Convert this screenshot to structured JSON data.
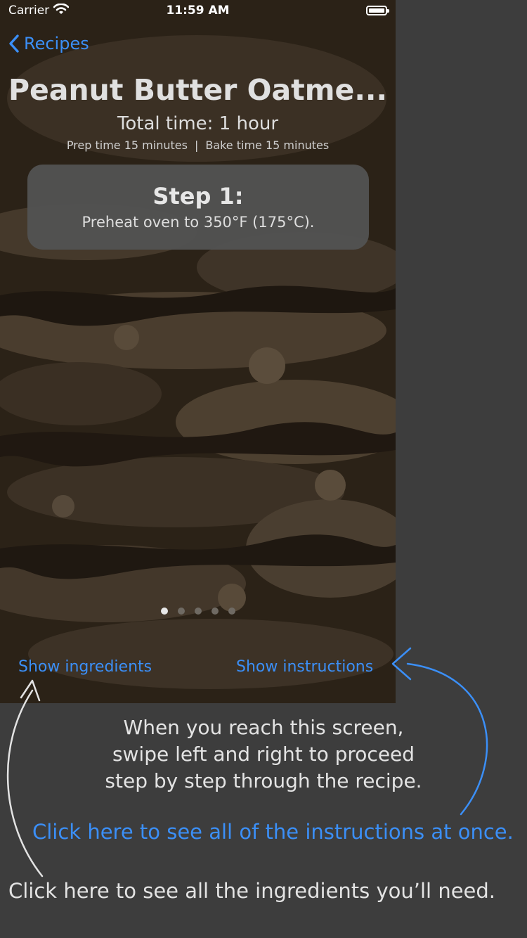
{
  "status_bar": {
    "carrier": "Carrier",
    "time": "11:59 AM"
  },
  "nav": {
    "back_label": "Recipes"
  },
  "recipe": {
    "title": "Peanut Butter Oatme...",
    "total_time": "Total time: 1 hour",
    "prep_time": "Prep time  15 minutes",
    "bake_time": "Bake time  15 minutes",
    "separator": "|"
  },
  "step": {
    "title": "Step 1:",
    "text": "Preheat oven to 350°F (175°C)."
  },
  "pager": {
    "count": 5,
    "current": 1
  },
  "links": {
    "ingredients": "Show ingredients",
    "instructions": "Show instructions"
  },
  "annotations": {
    "swipe_line1": "When you reach this screen,",
    "swipe_line2": "swipe left and right to proceed",
    "swipe_line3": "step by step through the recipe.",
    "instructions_callout": "Click here to see all of the instructions at once.",
    "ingredients_callout": "Click here to see all the ingredients you’ll need."
  },
  "colors": {
    "accent": "#3b8ff7",
    "page_background": "#3d3d3d",
    "card": "#525252"
  }
}
